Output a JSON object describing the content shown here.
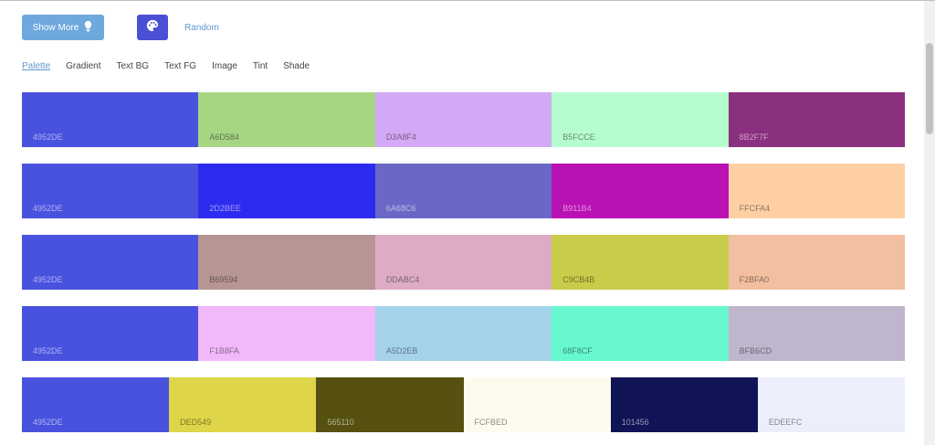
{
  "toolbar": {
    "show_more_label": "Show More",
    "random_label": "Random"
  },
  "tabs": [
    "Palette",
    "Gradient",
    "Text BG",
    "Text FG",
    "Image",
    "Tint",
    "Shade"
  ],
  "active_tab": "Palette",
  "colors": {
    "accent": "#4a4fd4",
    "link": "#5f98cf",
    "button": "#6fa8dc"
  },
  "palettes": [
    [
      "4952DE",
      "A6D584",
      "D3A8F4",
      "B5FCCE",
      "8B2F7F"
    ],
    [
      "4952DE",
      "2D2BEE",
      "6A68C6",
      "B911B4",
      "FFCFA4"
    ],
    [
      "4952DE",
      "B69594",
      "DDABC4",
      "C9CB4B",
      "F2BFA0"
    ],
    [
      "4952DE",
      "F1B8FA",
      "A5D2EB",
      "68F8CF",
      "BFB6CD"
    ],
    [
      "4952DE",
      "DED549",
      "565110",
      "FCFBED",
      "101456",
      "EDEEFC"
    ]
  ]
}
